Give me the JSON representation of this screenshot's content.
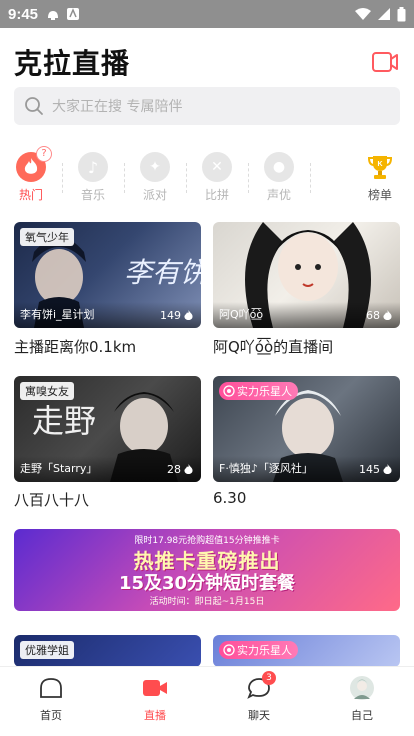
{
  "status_bar": {
    "time": "9:45"
  },
  "header": {
    "title": "克拉直播"
  },
  "search": {
    "placeholder": "大家正在搜 专属陪伴"
  },
  "categories": [
    {
      "label": "热门",
      "icon": "flame-icon",
      "active": true
    },
    {
      "label": "音乐",
      "icon": "music-icon"
    },
    {
      "label": "派对",
      "icon": "party-icon"
    },
    {
      "label": "比拼",
      "icon": "swords-icon"
    },
    {
      "label": "声优",
      "icon": "voice-icon"
    },
    {
      "label": "榜单",
      "icon": "trophy-icon"
    }
  ],
  "help_badge": "?",
  "rooms": [
    {
      "tag": "氧气少年",
      "host": "李有饼i_星计划",
      "heat": "149",
      "title": "主播距离你0.1km"
    },
    {
      "tag": "",
      "host": "阿Q吖ó͟͞ò",
      "heat": "68",
      "title": "阿Q吖ó͟͞ò的直播间"
    },
    {
      "tag": "寓嗅女友",
      "host": "走野「Starry」",
      "heat": "28",
      "title": "八百八十八"
    },
    {
      "tag": "实力乐星人",
      "host": "F·慎独♪「逐风社」",
      "heat": "145",
      "title": "6.30"
    }
  ],
  "banner": {
    "top": "限时17.98元抢购超值15分钟推推卡",
    "main": "热推卡重磅推出",
    "sub": "15及30分钟短时套餐",
    "time": "活动时间：即日起~1月15日"
  },
  "partial_rooms": [
    {
      "tag": "优雅学姐"
    },
    {
      "tag": "实力乐星人"
    }
  ],
  "tabbar": [
    {
      "label": "首页",
      "icon": "home-icon"
    },
    {
      "label": "直播",
      "icon": "video-camera-icon",
      "active": true
    },
    {
      "label": "聊天",
      "icon": "chat-icon",
      "badge": "3"
    },
    {
      "label": "自己",
      "icon": "avatar-icon"
    }
  ],
  "colors": {
    "accent": "#ff4d4f",
    "statusbar": "#8f8f8f"
  }
}
